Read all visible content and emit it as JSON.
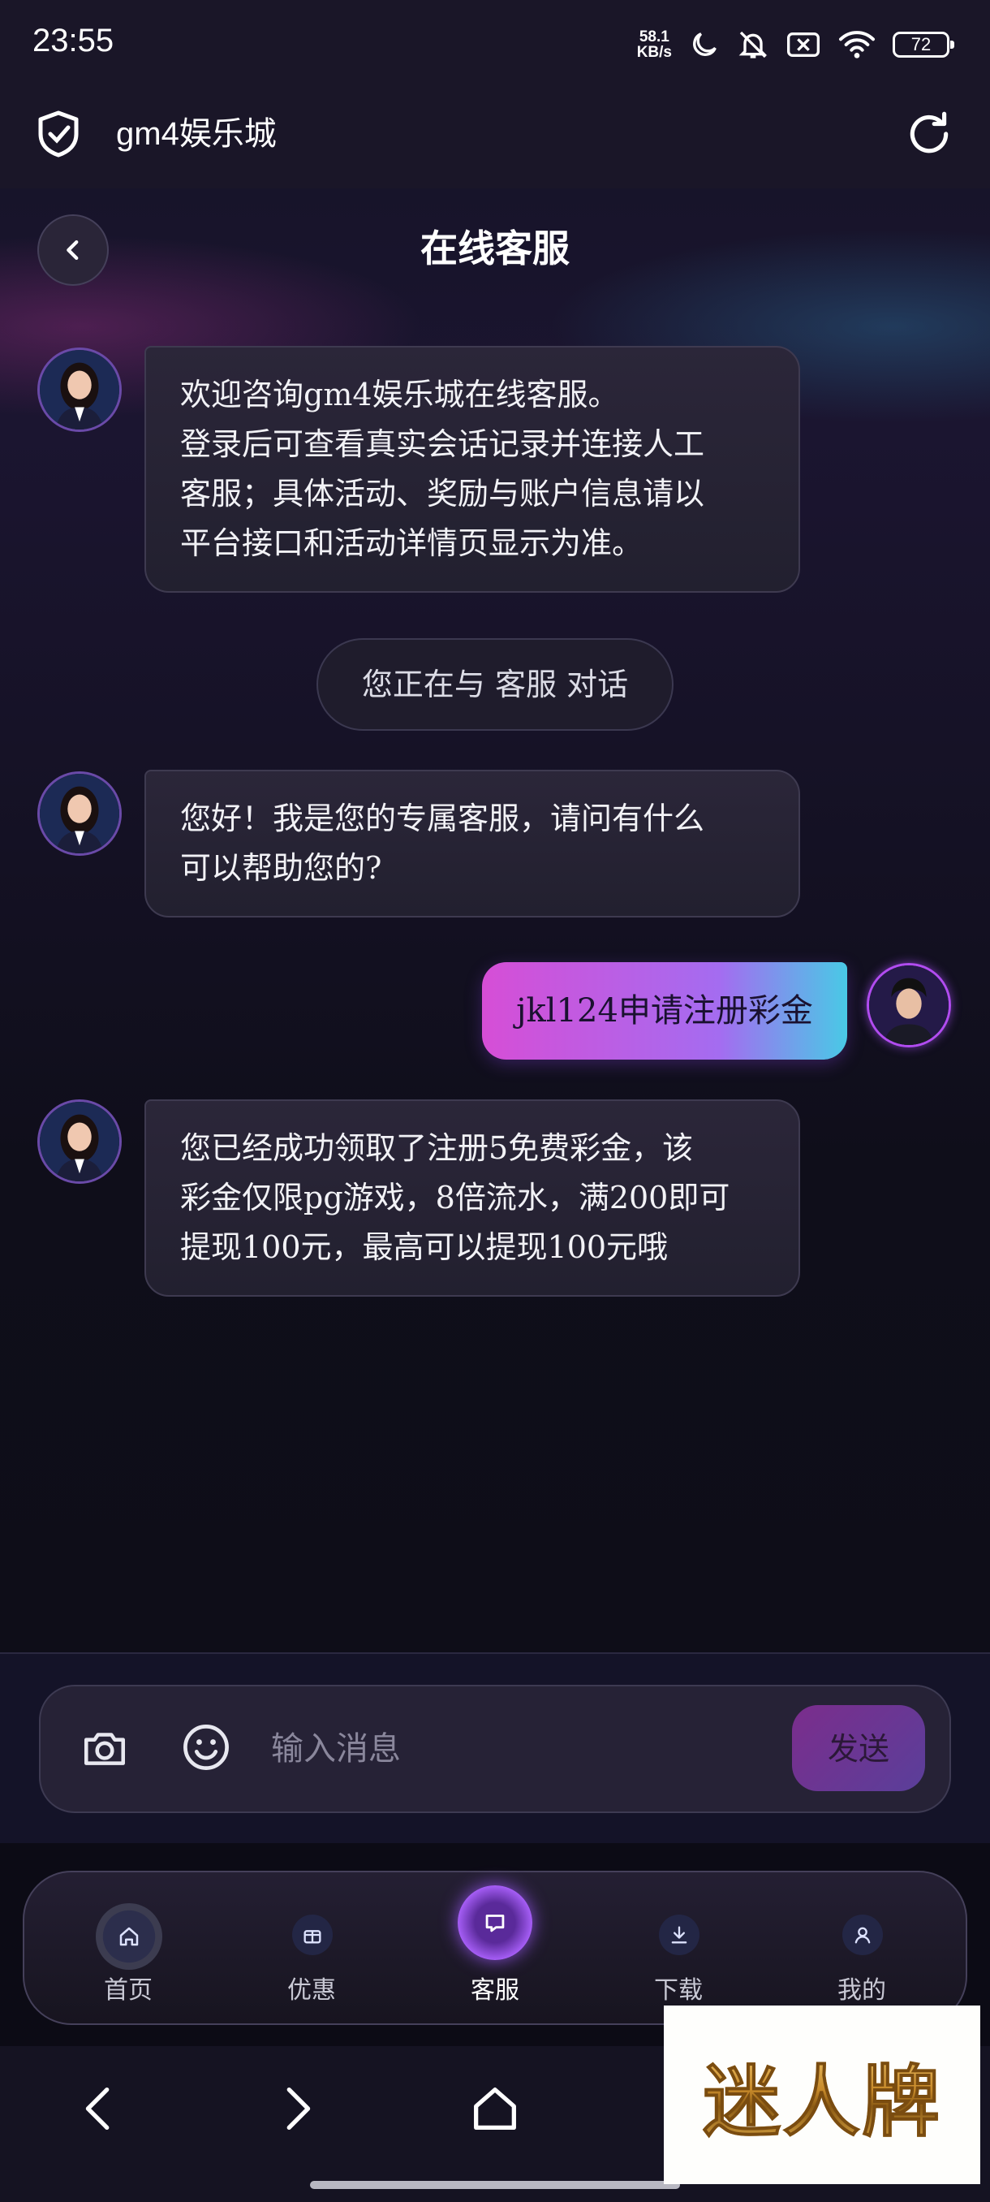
{
  "status_bar": {
    "time": "23:55",
    "net_speed_value": "58.1",
    "net_speed_unit": "KB/s",
    "battery": "72",
    "icons": [
      "moon-icon",
      "bell-off-icon",
      "sim-x-icon",
      "wifi-icon",
      "battery-icon"
    ]
  },
  "browser": {
    "site_title": "gm4娱乐城",
    "icons": [
      "shield-check-icon",
      "reload-icon"
    ]
  },
  "header": {
    "title": "在线客服",
    "back_icon": "chevron-left-icon"
  },
  "messages": [
    {
      "sender": "agent",
      "lines": [
        "欢迎咨询gm4娱乐城在线客服。",
        "登录后可查看真实会话记录并连接人工",
        "客服；具体活动、奖励与账户信息请以",
        "平台接口和活动详情页显示为准。"
      ]
    },
    {
      "sender": "system",
      "text": "您正在与 客服 对话"
    },
    {
      "sender": "agent",
      "lines": [
        "您好！我是您的专属客服，请问有什么",
        "可以帮助您的?"
      ]
    },
    {
      "sender": "user",
      "text": "jkl124申请注册彩金"
    },
    {
      "sender": "agent",
      "lines": [
        "您已经成功领取了注册5免费彩金，该",
        "彩金仅限pg游戏，8倍流水，满200即可",
        "提现100元，最高可以提现100元哦"
      ]
    }
  ],
  "input": {
    "placeholder": "输入消息",
    "value": "",
    "send_label": "发送",
    "icons": [
      "camera-icon",
      "emoji-icon"
    ]
  },
  "tabbar": {
    "items": [
      {
        "label": "首页",
        "icon": "home-icon"
      },
      {
        "label": "优惠",
        "icon": "gift-icon"
      },
      {
        "label": "客服",
        "icon": "chat-icon",
        "active": true
      },
      {
        "label": "下载",
        "icon": "download-icon"
      },
      {
        "label": "我的",
        "icon": "user-icon"
      }
    ]
  },
  "system_nav": {
    "icons": [
      "back-arrow-icon",
      "forward-arrow-icon",
      "home-outline-icon"
    ]
  },
  "watermark": {
    "text": "迷人牌"
  },
  "colors": {
    "accent_purple": "#a46cf0",
    "accent_pink": "#d64ed6",
    "accent_cyan": "#49c9e6",
    "background": "#0e0d18"
  }
}
